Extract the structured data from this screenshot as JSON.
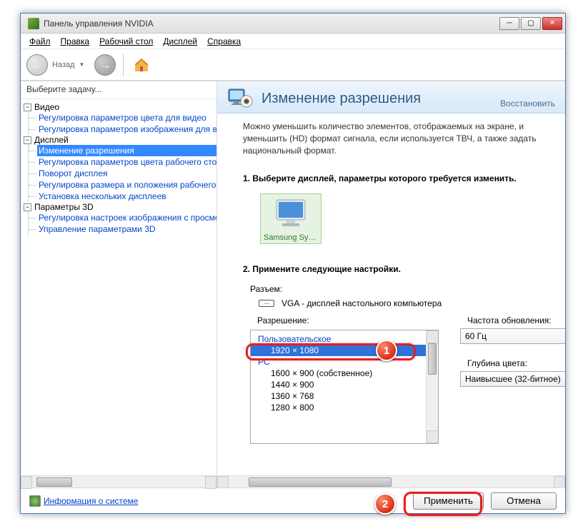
{
  "window": {
    "title": "Панель управления NVIDIA"
  },
  "menu": {
    "file": "Файл",
    "edit": "Правка",
    "desktop": "Рабочий стол",
    "display": "Дисплей",
    "help": "Справка"
  },
  "toolbar": {
    "back_label": "Назад"
  },
  "sidebar": {
    "title": "Выберите задачу...",
    "groups": [
      {
        "label": "Видео",
        "items": [
          "Регулировка параметров цвета для видео",
          "Регулировка параметров изображения для видео"
        ]
      },
      {
        "label": "Дисплей",
        "items": [
          "Изменение разрешения",
          "Регулировка параметров цвета рабочего стола",
          "Поворот дисплея",
          "Регулировка размера и положения рабочего стола",
          "Установка нескольких дисплеев"
        ],
        "selected": 0
      },
      {
        "label": "Параметры 3D",
        "items": [
          "Регулировка настроек изображения с просмотром",
          "Управление параметрами 3D"
        ]
      }
    ]
  },
  "content": {
    "title": "Изменение разрешения",
    "restore": "Восстановить",
    "description": "Можно уменьшить количество элементов, отображаемых на экране, и уменьшить (HD) формат сигнала, если используется ТВЧ, а также задать национальный формат.",
    "step1": "1. Выберите дисплей, параметры которого требуется изменить.",
    "monitor_name": "Samsung Syn...",
    "step2": "2. Примените следующие настройки.",
    "connector_label": "Разъем:",
    "connector_value": "VGA - дисплей настольного компьютера",
    "resolution_label": "Разрешение:",
    "res_groups": {
      "custom": "Пользовательское",
      "pc": "PC"
    },
    "resolutions": [
      "1920 × 1080",
      "1600 × 900 (собственное)",
      "1440 × 900",
      "1360 × 768",
      "1280 × 800"
    ],
    "refresh_label": "Частота обновления:",
    "refresh_value": "60 Гц",
    "depth_label": "Глубина цвета:",
    "depth_value": "Наивысшее (32-битное)"
  },
  "footer": {
    "sysinfo": "Информация о системе",
    "apply": "Применить",
    "cancel": "Отмена"
  },
  "callouts": {
    "one": "1",
    "two": "2"
  }
}
